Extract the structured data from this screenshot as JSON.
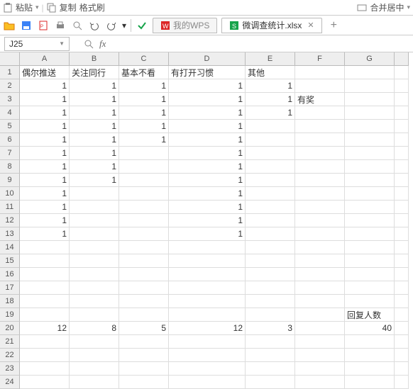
{
  "topbar": {
    "paste_label": "粘贴",
    "copy_label": "复制",
    "format_painter_label": "格式刷",
    "merge_label": "合并居中"
  },
  "tabs": {
    "my_wps_label": "我的WPS",
    "active_file_label": "微调查统计.xlsx"
  },
  "namebox": {
    "ref": "J25"
  },
  "fx_label": "fx",
  "columns": [
    "A",
    "B",
    "C",
    "D",
    "E",
    "F",
    "G",
    ""
  ],
  "row_numbers": [
    "1",
    "2",
    "3",
    "4",
    "5",
    "6",
    "7",
    "8",
    "9",
    "10",
    "11",
    "12",
    "13",
    "14",
    "15",
    "16",
    "17",
    "18",
    "19",
    "20",
    "21",
    "22",
    "23",
    "24"
  ],
  "headers": {
    "A": "偶尔推送",
    "B": "关注同行",
    "C": "基本不看",
    "D": "有打开习惯",
    "E": "其他"
  },
  "cells": [
    {
      "r": 2,
      "c": "A",
      "v": "1",
      "t": "n"
    },
    {
      "r": 2,
      "c": "B",
      "v": "1",
      "t": "n"
    },
    {
      "r": 2,
      "c": "C",
      "v": "1",
      "t": "n"
    },
    {
      "r": 2,
      "c": "D",
      "v": "1",
      "t": "n"
    },
    {
      "r": 2,
      "c": "E",
      "v": "1",
      "t": "n"
    },
    {
      "r": 3,
      "c": "A",
      "v": "1",
      "t": "n"
    },
    {
      "r": 3,
      "c": "B",
      "v": "1",
      "t": "n"
    },
    {
      "r": 3,
      "c": "C",
      "v": "1",
      "t": "n"
    },
    {
      "r": 3,
      "c": "D",
      "v": "1",
      "t": "n"
    },
    {
      "r": 3,
      "c": "E",
      "v": "1",
      "t": "n"
    },
    {
      "r": 3,
      "c": "F",
      "v": "有奖",
      "t": "t"
    },
    {
      "r": 4,
      "c": "A",
      "v": "1",
      "t": "n"
    },
    {
      "r": 4,
      "c": "B",
      "v": "1",
      "t": "n"
    },
    {
      "r": 4,
      "c": "C",
      "v": "1",
      "t": "n"
    },
    {
      "r": 4,
      "c": "D",
      "v": "1",
      "t": "n"
    },
    {
      "r": 4,
      "c": "E",
      "v": "1",
      "t": "n"
    },
    {
      "r": 5,
      "c": "A",
      "v": "1",
      "t": "n"
    },
    {
      "r": 5,
      "c": "B",
      "v": "1",
      "t": "n"
    },
    {
      "r": 5,
      "c": "C",
      "v": "1",
      "t": "n"
    },
    {
      "r": 5,
      "c": "D",
      "v": "1",
      "t": "n"
    },
    {
      "r": 6,
      "c": "A",
      "v": "1",
      "t": "n"
    },
    {
      "r": 6,
      "c": "B",
      "v": "1",
      "t": "n"
    },
    {
      "r": 6,
      "c": "C",
      "v": "1",
      "t": "n"
    },
    {
      "r": 6,
      "c": "D",
      "v": "1",
      "t": "n"
    },
    {
      "r": 7,
      "c": "A",
      "v": "1",
      "t": "n"
    },
    {
      "r": 7,
      "c": "B",
      "v": "1",
      "t": "n"
    },
    {
      "r": 7,
      "c": "D",
      "v": "1",
      "t": "n"
    },
    {
      "r": 8,
      "c": "A",
      "v": "1",
      "t": "n"
    },
    {
      "r": 8,
      "c": "B",
      "v": "1",
      "t": "n"
    },
    {
      "r": 8,
      "c": "D",
      "v": "1",
      "t": "n"
    },
    {
      "r": 9,
      "c": "A",
      "v": "1",
      "t": "n"
    },
    {
      "r": 9,
      "c": "B",
      "v": "1",
      "t": "n"
    },
    {
      "r": 9,
      "c": "D",
      "v": "1",
      "t": "n"
    },
    {
      "r": 10,
      "c": "A",
      "v": "1",
      "t": "n"
    },
    {
      "r": 10,
      "c": "D",
      "v": "1",
      "t": "n"
    },
    {
      "r": 11,
      "c": "A",
      "v": "1",
      "t": "n"
    },
    {
      "r": 11,
      "c": "D",
      "v": "1",
      "t": "n"
    },
    {
      "r": 12,
      "c": "A",
      "v": "1",
      "t": "n"
    },
    {
      "r": 12,
      "c": "D",
      "v": "1",
      "t": "n"
    },
    {
      "r": 13,
      "c": "A",
      "v": "1",
      "t": "n"
    },
    {
      "r": 13,
      "c": "D",
      "v": "1",
      "t": "n"
    },
    {
      "r": 19,
      "c": "G",
      "v": "回复人数",
      "t": "t"
    },
    {
      "r": 20,
      "c": "A",
      "v": "12",
      "t": "n"
    },
    {
      "r": 20,
      "c": "B",
      "v": "8",
      "t": "n"
    },
    {
      "r": 20,
      "c": "C",
      "v": "5",
      "t": "n"
    },
    {
      "r": 20,
      "c": "D",
      "v": "12",
      "t": "n"
    },
    {
      "r": 20,
      "c": "E",
      "v": "3",
      "t": "n"
    },
    {
      "r": 20,
      "c": "G",
      "v": "40",
      "t": "n"
    }
  ]
}
